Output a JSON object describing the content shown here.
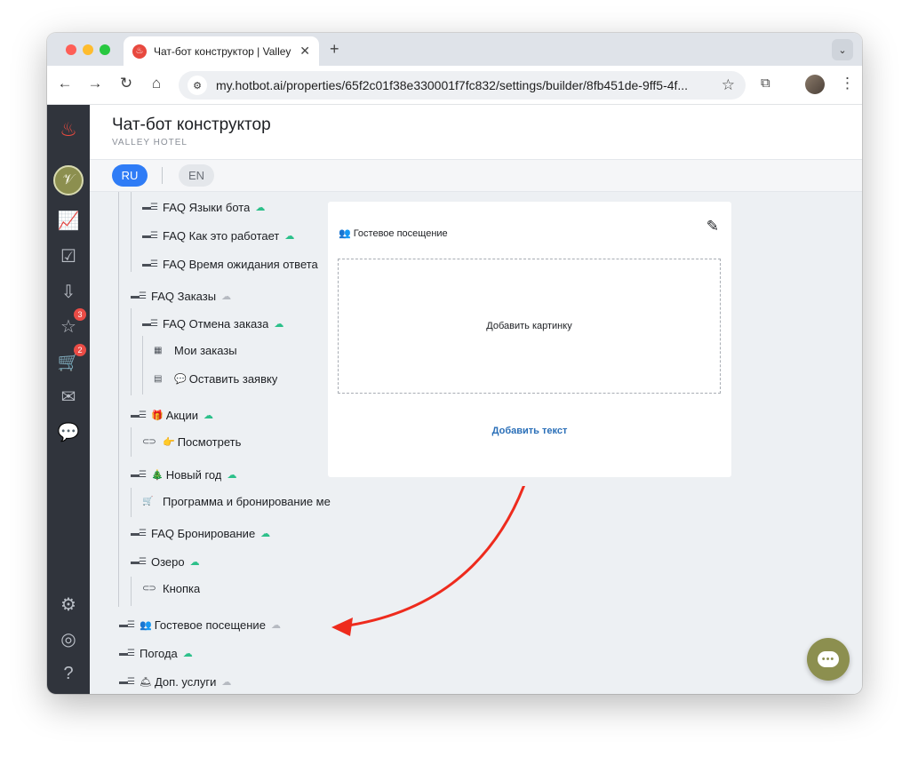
{
  "browser": {
    "tab_title": "Чат-бот конструктор | Valley Hotel",
    "url": "my.hotbot.ai/properties/65f2c01f38e330001f7fc832/settings/builder/8fb451de-9ff5-4f..."
  },
  "sidebar": {
    "badges": {
      "favorites": "3",
      "orders": "2"
    }
  },
  "header": {
    "title": "Чат-бот конструктор",
    "subtitle": "VALLEY HOTEL"
  },
  "languages": {
    "ru": "RU",
    "en": "EN"
  },
  "tree": {
    "faq_languages": "FAQ Языки бота",
    "faq_how": "FAQ Как это работает",
    "faq_wait": "FAQ Время ожидания ответа",
    "faq_orders": "FAQ Заказы",
    "faq_cancel": "FAQ Отмена заказа",
    "my_orders": "Мои заказы",
    "leave_request": "Оставить заявку",
    "promos": "Акции",
    "view": "Посмотреть",
    "new_year": "Новый год",
    "program": "Программа и бронирование ме",
    "faq_booking": "FAQ Бронирование",
    "lake": "Озеро",
    "button": "Кнопка",
    "guest_visit": "Гостевое посещение",
    "weather": "Погода",
    "extra_services": "Доп. услуги"
  },
  "card": {
    "title": "Гостевое посещение",
    "add_image": "Добавить картинку",
    "add_text": "Добавить текст"
  },
  "colors": {
    "accent": "#2f7cf6",
    "sidebar": "#30343c",
    "brand_olive": "#8c8f4f",
    "ai_on": "#2cc08a",
    "annotation_arrow": "#ee2b1d"
  }
}
